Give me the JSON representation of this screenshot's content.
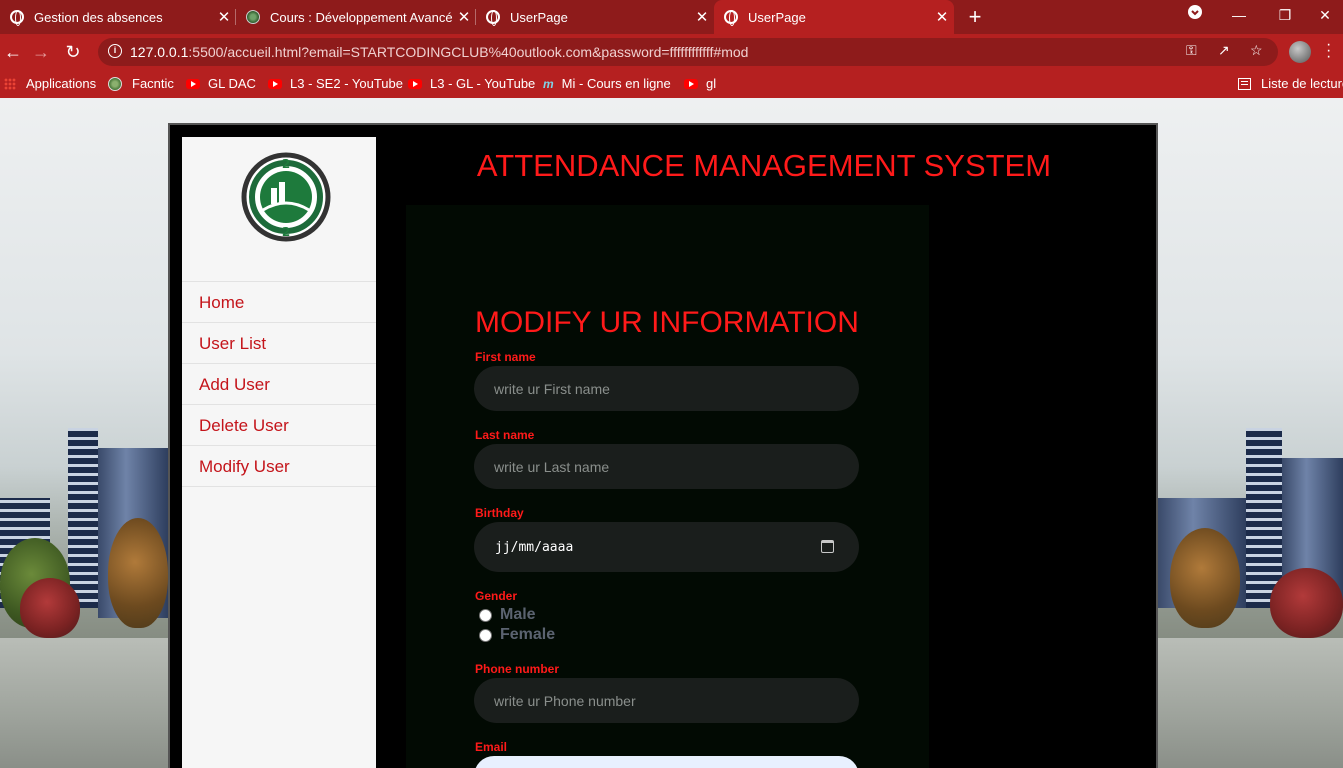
{
  "browser": {
    "tabs": [
      {
        "title": "Gestion des absences",
        "close": "✕"
      },
      {
        "title": "Cours : Développement Avancé d",
        "close": "✕"
      },
      {
        "title": "UserPage",
        "close": "✕"
      },
      {
        "title": "UserPage",
        "close": "✕"
      }
    ],
    "new_tab": "+",
    "url_host": "127.0.0.1",
    "url_rest": ":5500/accueil.html?email=STARTCODINGCLUB%40outlook.com&password=ffffffffffff#mod",
    "bookmarks": [
      {
        "label": "Applications",
        "icon": "apps-icon"
      },
      {
        "label": "Facntic",
        "icon": "site-icon"
      },
      {
        "label": "GL DAC",
        "icon": "youtube-icon"
      },
      {
        "label": "L3 - SE2 - YouTube",
        "icon": "youtube-icon"
      },
      {
        "label": "L3 - GL - YouTube",
        "icon": "youtube-icon"
      },
      {
        "label": "Mi - Cours en ligne",
        "icon": "moodle-icon"
      },
      {
        "label": "gl",
        "icon": "youtube-icon"
      }
    ],
    "reading_list": "Liste de lecture",
    "colors": {
      "tabbar": "#8e1b1b",
      "toolbar": "#b52020"
    }
  },
  "app": {
    "title": "ATTENDANCE MANAGEMENT SYSTEM",
    "menu": [
      "Home",
      "User List",
      "Add User",
      "Delete User",
      "Modify User"
    ]
  },
  "form": {
    "title": "MODIFY UR INFORMATION",
    "first_name": {
      "label": "First name",
      "placeholder": "write ur First name"
    },
    "last_name": {
      "label": "Last name",
      "placeholder": "write ur Last name"
    },
    "birthday": {
      "label": "Birthday",
      "value": "jj/mm/aaaa"
    },
    "gender": {
      "label": "Gender",
      "options": [
        "Male",
        "Female"
      ]
    },
    "phone": {
      "label": "Phone number",
      "placeholder": "write ur Phone number"
    },
    "email": {
      "label": "Email"
    },
    "colors": {
      "accent": "#ff1a1a",
      "field_bg": "#1a1e1c"
    }
  }
}
